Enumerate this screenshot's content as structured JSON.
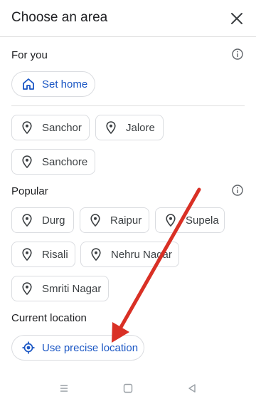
{
  "header": {
    "title": "Choose an area"
  },
  "for_you": {
    "label": "For you",
    "set_home_label": "Set home",
    "recent": [
      "Sanchor",
      "Jalore",
      "Sanchore"
    ]
  },
  "popular": {
    "label": "Popular",
    "places": [
      "Durg",
      "Raipur",
      "Supela",
      "Risali",
      "Nehru Nagar",
      "Smriti Nagar"
    ]
  },
  "current_location": {
    "label": "Current location",
    "button_label": "Use precise location"
  },
  "colors": {
    "accent": "#1a56c4",
    "annotation_arrow": "#d93025",
    "chip_border": "#dadce0"
  },
  "icons": {
    "close": "close-icon",
    "info": "info-icon",
    "home": "home-icon",
    "pin": "location-pin-icon",
    "gps": "my-location-icon",
    "nav": [
      "recents-nav-icon",
      "home-nav-icon",
      "back-nav-icon"
    ]
  }
}
